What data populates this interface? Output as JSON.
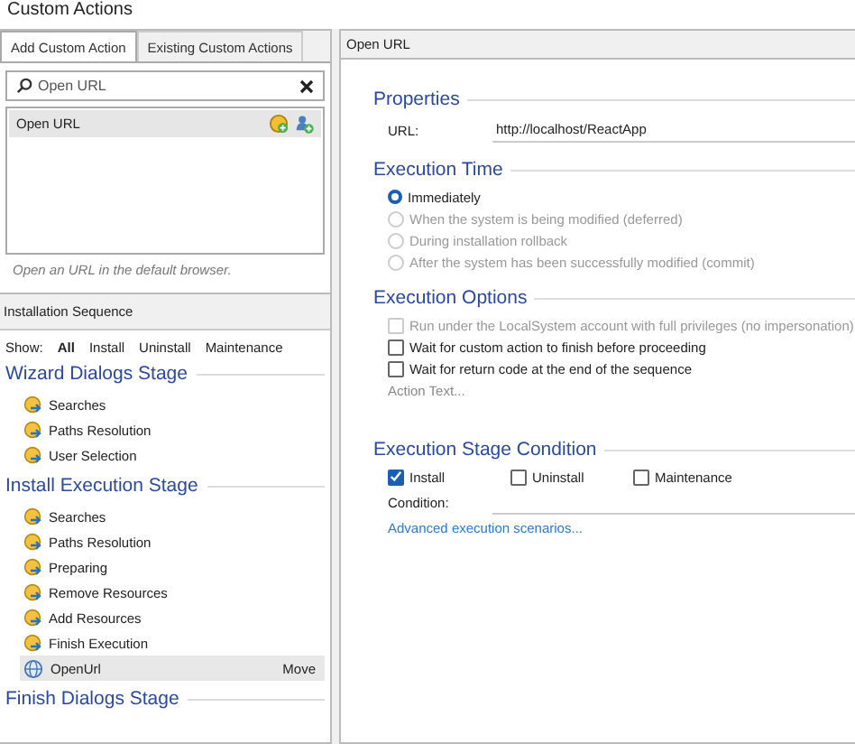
{
  "window": {
    "title": "Custom Actions"
  },
  "left_panel": {
    "tabs": [
      {
        "label": "Add Custom Action",
        "selected": true
      },
      {
        "label": "Existing Custom Actions",
        "selected": false
      }
    ],
    "search": {
      "value": "Open URL"
    },
    "actions": [
      {
        "label": "Open URL",
        "selected": true
      }
    ],
    "description": "Open an URL in the default browser."
  },
  "sequence": {
    "title": "Installation Sequence",
    "show_label": "Show:",
    "filters": [
      {
        "label": "All",
        "selected": true
      },
      {
        "label": "Install",
        "selected": false
      },
      {
        "label": "Uninstall",
        "selected": false
      },
      {
        "label": "Maintenance",
        "selected": false
      }
    ],
    "stages": [
      {
        "title": "Wizard Dialogs Stage",
        "items": [
          {
            "label": "Searches",
            "kind": "standard",
            "selected": false
          },
          {
            "label": "Paths Resolution",
            "kind": "standard",
            "selected": false
          },
          {
            "label": "User Selection",
            "kind": "standard",
            "selected": false
          }
        ]
      },
      {
        "title": "Install Execution Stage",
        "items": [
          {
            "label": "Searches",
            "kind": "standard",
            "selected": false
          },
          {
            "label": "Paths Resolution",
            "kind": "standard",
            "selected": false
          },
          {
            "label": "Preparing",
            "kind": "standard",
            "selected": false
          },
          {
            "label": "Remove Resources",
            "kind": "standard",
            "selected": false
          },
          {
            "label": "Add Resources",
            "kind": "standard",
            "selected": false
          },
          {
            "label": "Finish Execution",
            "kind": "standard",
            "selected": false
          },
          {
            "label": "OpenUrl",
            "kind": "custom",
            "selected": true,
            "action": "Move"
          }
        ]
      },
      {
        "title": "Finish Dialogs Stage"
      }
    ]
  },
  "right_panel": {
    "header": "Open URL",
    "properties": {
      "title": "Properties",
      "url_label": "URL:",
      "url_value": "http://localhost/ReactApp"
    },
    "execution_time": {
      "title": "Execution Time",
      "options": [
        {
          "label": "Immediately",
          "selected": true,
          "disabled": false
        },
        {
          "label": "When the system is being modified (deferred)",
          "selected": false,
          "disabled": true
        },
        {
          "label": "During installation rollback",
          "selected": false,
          "disabled": true
        },
        {
          "label": "After the system has been successfully modified (commit)",
          "selected": false,
          "disabled": true
        }
      ]
    },
    "execution_options": {
      "title": "Execution Options",
      "options": [
        {
          "label": "Run under the LocalSystem account with full privileges (no impersonation)",
          "checked": false,
          "disabled": true
        },
        {
          "label": "Wait for custom action to finish before proceeding",
          "checked": false,
          "disabled": false
        },
        {
          "label": "Wait for return code at the end of the sequence",
          "checked": false,
          "disabled": false
        }
      ],
      "action_text": "Action Text..."
    },
    "stage_condition": {
      "title": "Execution Stage Condition",
      "checks": [
        {
          "label": "Install",
          "checked": true
        },
        {
          "label": "Uninstall",
          "checked": false
        },
        {
          "label": "Maintenance",
          "checked": false
        }
      ],
      "condition_label": "Condition:",
      "advanced_link": "Advanced execution scenarios..."
    }
  }
}
